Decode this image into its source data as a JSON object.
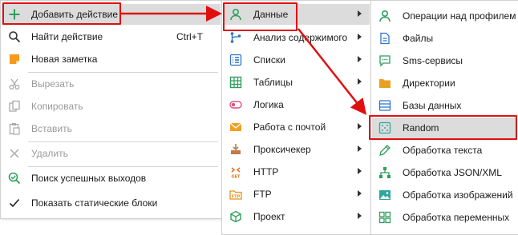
{
  "menu_main": {
    "add_action": "Добавить действие",
    "find_action": "Найти действие",
    "find_action_shortcut": "Ctrl+T",
    "new_note": "Новая заметка",
    "cut": "Вырезать",
    "copy": "Копировать",
    "paste": "Вставить",
    "delete": "Удалить",
    "search_success": "Поиск успешных выходов",
    "show_static": "Показать статические блоки"
  },
  "menu_add": {
    "data": "Данные",
    "content_analysis": "Анализ содержимого",
    "lists": "Списки",
    "tables": "Таблицы",
    "logic": "Логика",
    "mail": "Работа с почтой",
    "proxy": "Проксичекер",
    "http": "HTTP",
    "ftp": "FTP",
    "project": "Проект"
  },
  "menu_data": {
    "profile_ops": "Операции над профилем",
    "files": "Файлы",
    "sms": "Sms-сервисы",
    "directories": "Директории",
    "databases": "Базы данных",
    "random": "Random",
    "text": "Обработка текста",
    "json_xml": "Обработка JSON/XML",
    "images": "Обработка изображений",
    "variables": "Обработка переменных"
  },
  "icons": {
    "add": "plus-icon",
    "find": "search-icon",
    "note": "note-icon",
    "cut": "scissors-icon",
    "copy": "copy-icon",
    "paste": "paste-icon",
    "delete": "close-icon",
    "search_success": "search-check-icon",
    "show_static": "checkmark-icon"
  },
  "colors": {
    "highlight": "#dcdcdc",
    "annotation_red": "#e01010",
    "green": "#2e9e5b",
    "blue": "#2a74c9",
    "orange": "#e8901a",
    "pink": "#e0507a",
    "disabled_text": "#9a9a9a"
  }
}
